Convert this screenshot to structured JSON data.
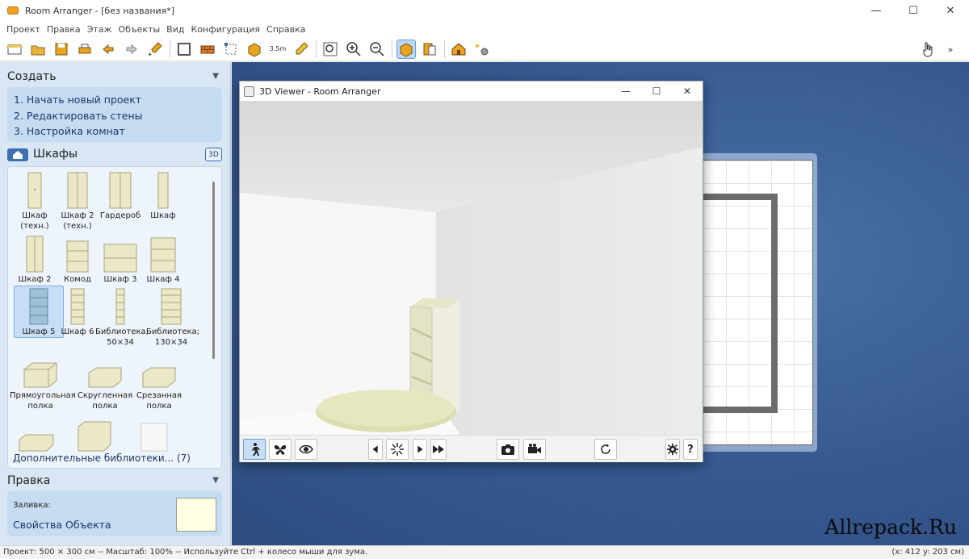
{
  "window": {
    "title": "Room Arranger - [без названия*]",
    "minimize": "—",
    "maximize": "☐",
    "close": "✕"
  },
  "menu": [
    "Проект",
    "Правка",
    "Этаж",
    "Объекты",
    "Вид",
    "Конфигурация",
    "Справка"
  ],
  "toolbar": {
    "dimension_label": "3.5m"
  },
  "create_panel": {
    "title": "Создать",
    "collapse_arrow": "▼",
    "steps": [
      "1. Начать новый проект",
      "2. Редактировать стены",
      "3. Настройка комнат"
    ]
  },
  "category": {
    "label": "Шкафы",
    "btn_3d": "3D"
  },
  "library_items": [
    "Шкаф (техн.)",
    "Шкаф 2 (техн.)",
    "Гардероб",
    "Шкаф",
    "Шкаф 2",
    "Комод",
    "Шкаф 3",
    "Шкаф 4",
    "Шкаф 5",
    "Шкаф 6",
    "Библиотека; 50×34",
    "Библиотека; 130×34",
    "Прямоугольная полка",
    "Скругленная полка",
    "Срезанная полка"
  ],
  "more_libraries": "Дополнительные библиотеки... (7)",
  "edit_panel": {
    "title": "Правка",
    "collapse_arrow": "▼",
    "fill_label": "Заливка:",
    "properties_link": "Свойства Объекта",
    "fill_color": "#fefee0"
  },
  "viewer": {
    "title": "3D Viewer - Room Arranger",
    "minimize": "—",
    "maximize": "☐",
    "close": "✕",
    "help_label": "?"
  },
  "watermark": "Allrepack.Ru",
  "status": {
    "left": "Проект: 500 × 300 см -- Масштаб: 100% -- Используйте Ctrl + колесо мыши для зума.",
    "right": "(x: 412 y: 203 см)"
  },
  "colors": {
    "workspace": "#35588f",
    "panel": "#d9e6f4",
    "accent": "#3d6fb3",
    "furniture": "#e8e6c3"
  }
}
